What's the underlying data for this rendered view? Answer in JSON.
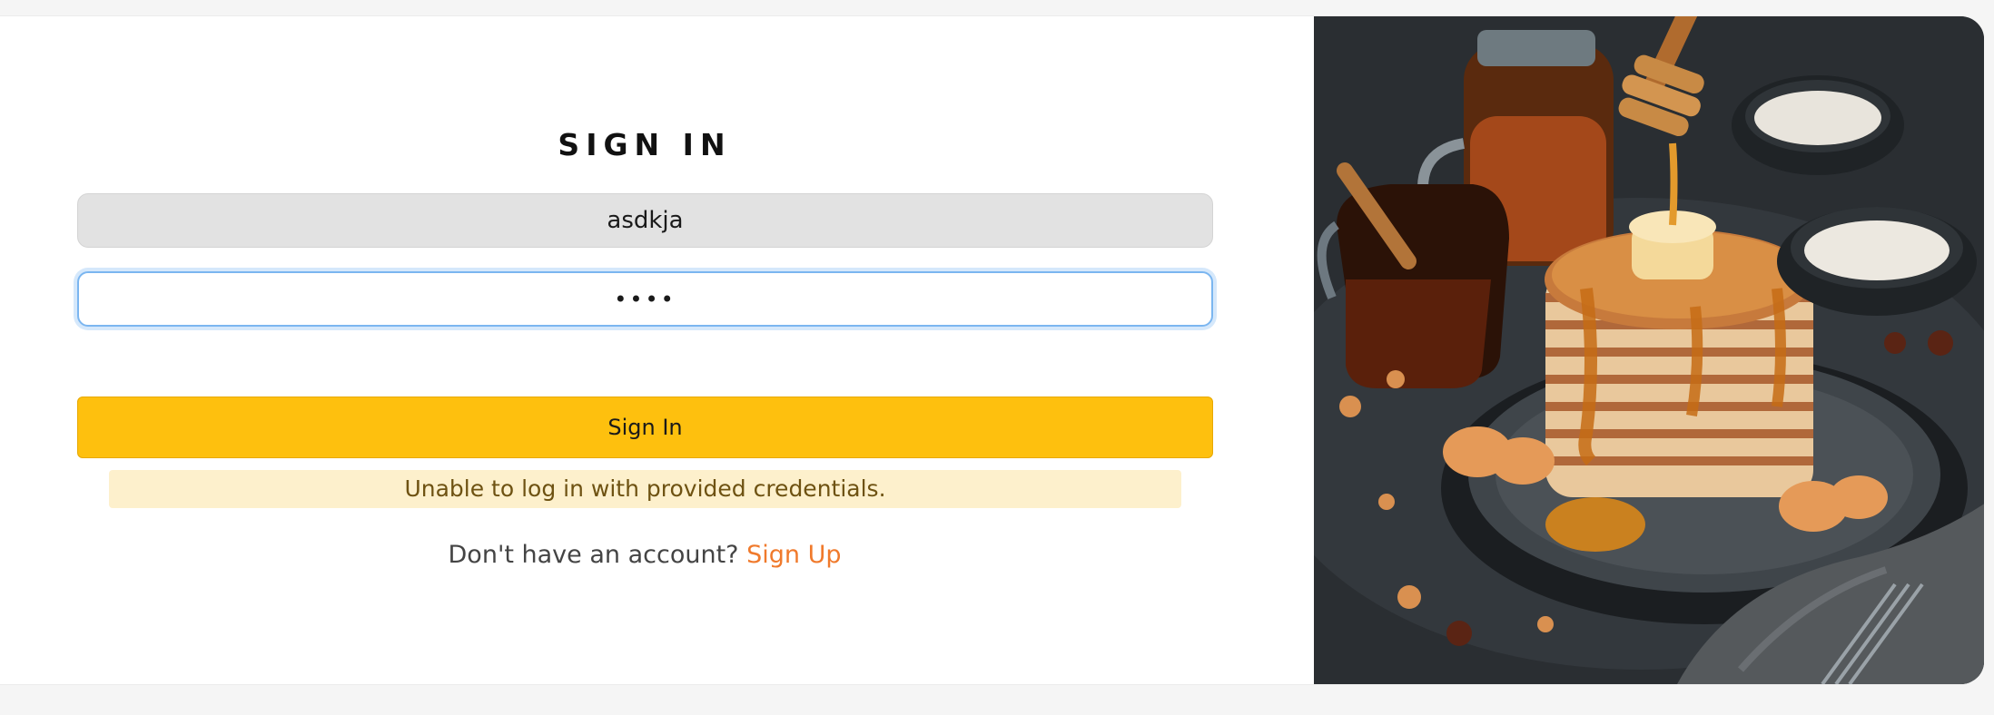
{
  "signin": {
    "title": "SIGN IN",
    "username_value": "asdkja",
    "password_value": "••••",
    "button_label": "Sign In",
    "error_message": "Unable to log in with provided credentials.",
    "signup_prompt": "Don't have an account?",
    "signup_link": "Sign Up"
  },
  "image": {
    "description_icon": "pancakes-with-honey-illustration"
  },
  "colors": {
    "accent_button": "#fec00e",
    "error_background": "#fdf0cc",
    "error_text": "#6e5212",
    "link": "#f07a2c",
    "focus_ring": "#7bb6f0"
  }
}
